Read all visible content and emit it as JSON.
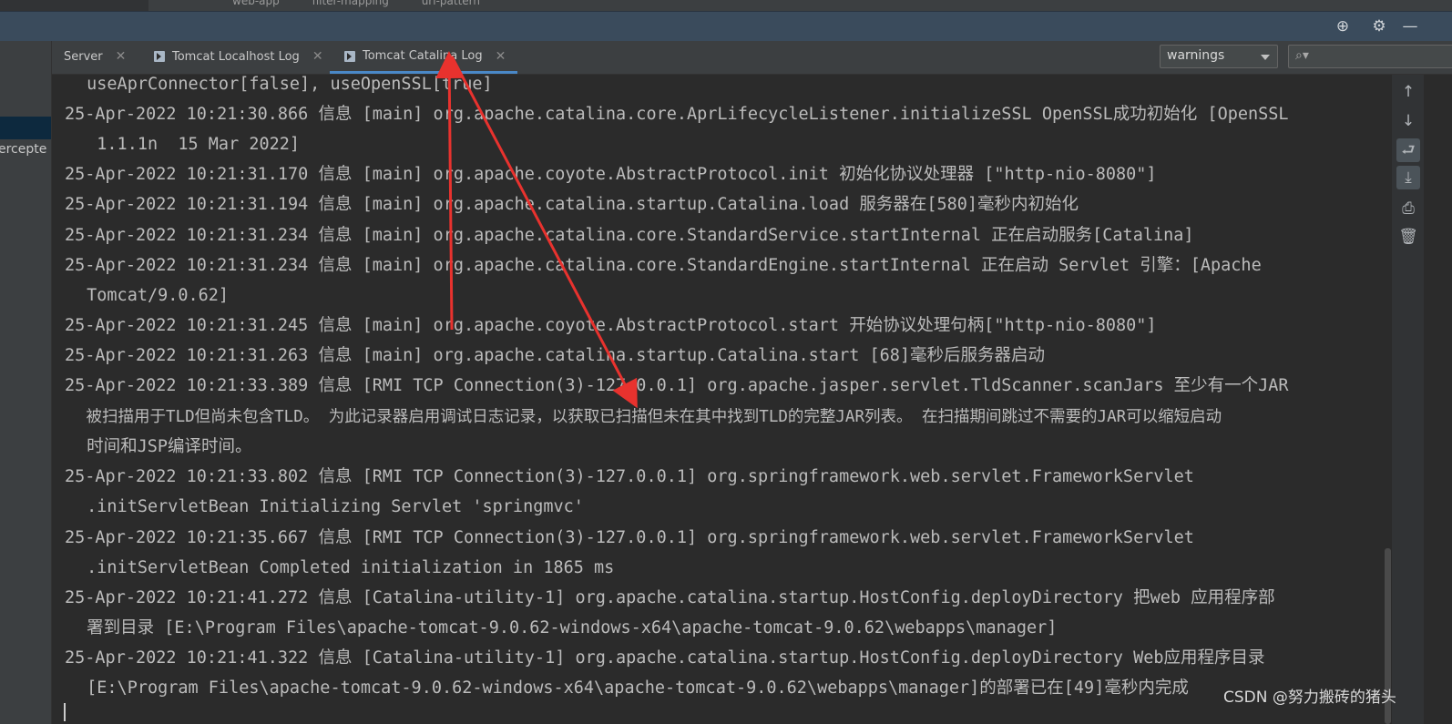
{
  "top_bar": {
    "crumbs": [
      "web-app",
      "filter-mapping",
      "url-pattern"
    ]
  },
  "tool_header": {
    "icons": [
      "crosshair-icon",
      "gear-icon",
      "minimize-icon"
    ]
  },
  "left_panel": {
    "partial_item": "ercepte"
  },
  "tabs": [
    {
      "label": "Server",
      "icon": "none"
    },
    {
      "label": "Tomcat Localhost Log",
      "icon": "console-icon"
    },
    {
      "label": "Tomcat Catalina Log",
      "icon": "console-icon",
      "active": true
    }
  ],
  "filter": {
    "level": "warnings",
    "search_value": ""
  },
  "log_lines": [
    " useAprConnector[false], useOpenSSL[true]",
    "25-Apr-2022 10:21:30.866 信息 [main] org.apache.catalina.core.AprLifecycleListener.initializeSSL OpenSSL成功初始化 [OpenSSL",
    "  1.1.1n  15 Mar 2022]",
    "25-Apr-2022 10:21:31.170 信息 [main] org.apache.coyote.AbstractProtocol.init 初始化协议处理器 [\"http-nio-8080\"]",
    "25-Apr-2022 10:21:31.194 信息 [main] org.apache.catalina.startup.Catalina.load 服务器在[580]毫秒内初始化",
    "25-Apr-2022 10:21:31.234 信息 [main] org.apache.catalina.core.StandardService.startInternal 正在启动服务[Catalina]",
    "25-Apr-2022 10:21:31.234 信息 [main] org.apache.catalina.core.StandardEngine.startInternal 正在启动 Servlet 引擎：[Apache",
    " Tomcat/9.0.62]",
    "25-Apr-2022 10:21:31.245 信息 [main] org.apache.coyote.AbstractProtocol.start 开始协议处理句柄[\"http-nio-8080\"]",
    "25-Apr-2022 10:21:31.263 信息 [main] org.apache.catalina.startup.Catalina.start [68]毫秒后服务器启动",
    "25-Apr-2022 10:21:33.389 信息 [RMI TCP Connection(3)-127.0.0.1] org.apache.jasper.servlet.TldScanner.scanJars 至少有一个JAR",
    " 被扫描用于TLD但尚未包含TLD。 为此记录器启用调试日志记录，以获取已扫描但未在其中找到TLD的完整JAR列表。 在扫描期间跳过不需要的JAR可以缩短启动",
    " 时间和JSP编译时间。",
    "25-Apr-2022 10:21:33.802 信息 [RMI TCP Connection(3)-127.0.0.1] org.springframework.web.servlet.FrameworkServlet",
    " .initServletBean Initializing Servlet 'springmvc'",
    "25-Apr-2022 10:21:35.667 信息 [RMI TCP Connection(3)-127.0.0.1] org.springframework.web.servlet.FrameworkServlet",
    " .initServletBean Completed initialization in 1865 ms",
    "25-Apr-2022 10:21:41.272 信息 [Catalina-utility-1] org.apache.catalina.startup.HostConfig.deployDirectory 把web 应用程序部",
    " 署到目录 [E:\\Program Files\\apache-tomcat-9.0.62-windows-x64\\apache-tomcat-9.0.62\\webapps\\manager]",
    "25-Apr-2022 10:21:41.322 信息 [Catalina-utility-1] org.apache.catalina.startup.HostConfig.deployDirectory Web应用程序目录",
    " [E:\\Program Files\\apache-tomcat-9.0.62-windows-x64\\apache-tomcat-9.0.62\\webapps\\manager]的部署已在[49]毫秒内完成"
  ],
  "right_toolbar": [
    "arrow-up-icon",
    "arrow-down-icon",
    "soft-wrap-icon",
    "scroll-to-end-icon",
    "print-icon",
    "trash-icon"
  ],
  "annotation_color": "#e8322e",
  "watermark": "CSDN @努力搬砖的猪头"
}
